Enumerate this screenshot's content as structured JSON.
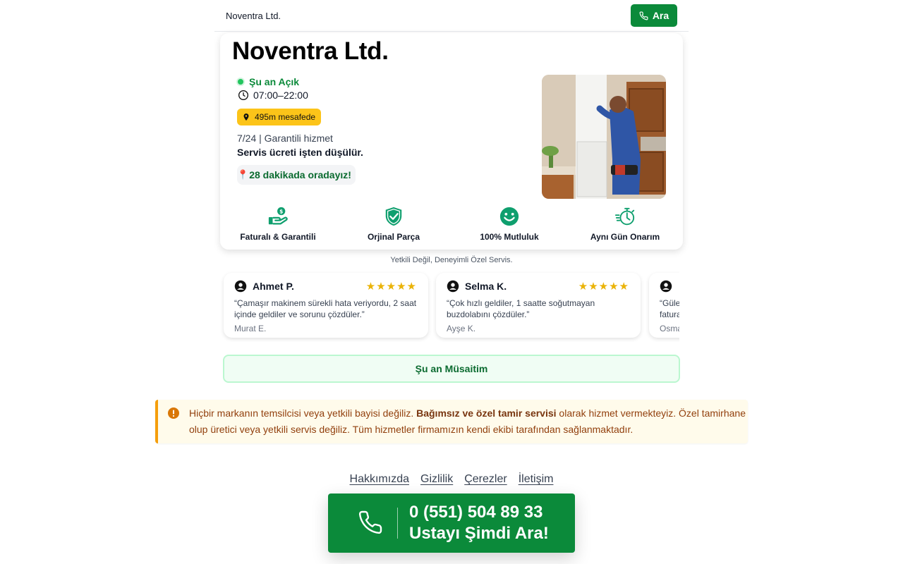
{
  "header": {
    "brand": "Noventra Ltd.",
    "call_label": "Ara"
  },
  "card": {
    "title": "Noventra Ltd.",
    "open_status": "Şu an Açık",
    "hours": "07:00–22:00",
    "distance": "495m mesafede",
    "service_line": "7/24 | Garantili hizmet",
    "service_fee": "Servis ücreti işten düşülür.",
    "eta_pin": "📍",
    "eta": "28 dakikada oradayız!",
    "features": [
      {
        "icon": "hand-money-icon",
        "label": "Faturalı & Garantili"
      },
      {
        "icon": "shield-check-icon",
        "label": "Orjinal Parça"
      },
      {
        "icon": "smile-icon",
        "label": "100% Mutluluk"
      },
      {
        "icon": "stopwatch-icon",
        "label": "Aynı Gün Onarım"
      }
    ]
  },
  "tagline": "Yetkili Değil, Deneyimli Özel Servis.",
  "reviews": [
    {
      "name": "Ahmet P.",
      "stars": "★★★★★",
      "text": "“Çamaşır makinem sürekli hata veriyordu, 2 saat içinde geldiler ve sorunu çözdüler.”",
      "author": "Murat E."
    },
    {
      "name": "Selma K.",
      "stars": "★★★★★",
      "text": "“Çok hızlı geldiler, 1 saatte soğutmayan buzdolabını çözdüler.”",
      "author": "Ayşe K."
    },
    {
      "name": "",
      "stars": "",
      "text": "“Güle fatura",
      "author": "Osma"
    }
  ],
  "availability": "Şu an Müsaitim",
  "warning": {
    "text_before": "Hiçbir markanın temsilcisi veya yetkili bayisi değiliz. ",
    "bold": "Bağımsız ve özel tamir servisi",
    "text_after": " olarak hizmet vermekteyiz. Özel tamirhane olup üretici veya yetkili servis değiliz. Tüm hizmetler firmamızın kendi ekibi tarafından sağlanmaktadır."
  },
  "footer_links": [
    "Hakkımızda",
    "Gizlilik",
    "Çerezler",
    "İletişim"
  ],
  "big_call": {
    "number": "0 (551) 504 89 33",
    "cta": "Ustayı Şimdi Ara!"
  },
  "colors": {
    "primary_green": "#0b8a3a",
    "distance_badge": "#fcc419",
    "warning_accent": "#f59e0b",
    "star": "#eab308"
  }
}
